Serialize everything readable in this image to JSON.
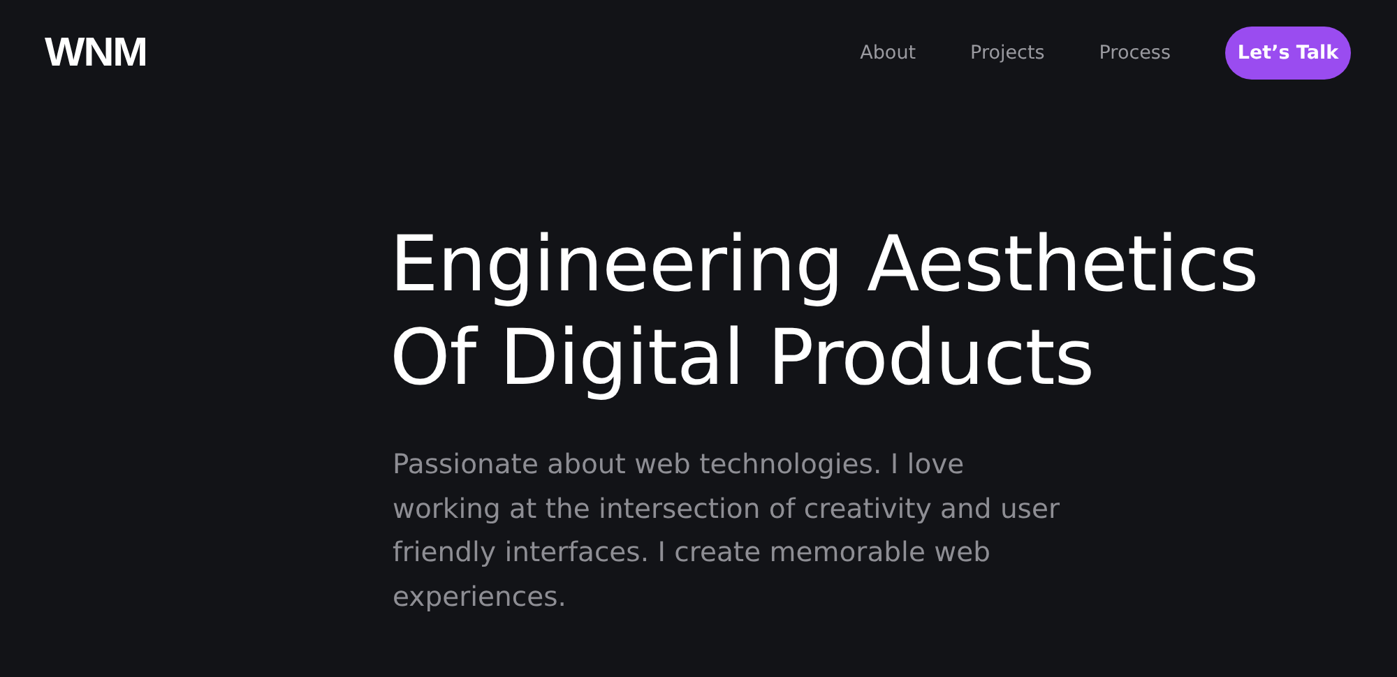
{
  "header": {
    "logo": "WNM",
    "nav": [
      {
        "label": "About"
      },
      {
        "label": "Projects"
      },
      {
        "label": "Process"
      }
    ],
    "cta": "Let’s Talk"
  },
  "hero": {
    "heading_lines": [
      "Engineering Aesthetics",
      "Of Digital Products"
    ],
    "intro": "Passionate about web technologies. I love working at the intersection of creativity and user friendly interfaces. I create memorable web experiences."
  }
}
